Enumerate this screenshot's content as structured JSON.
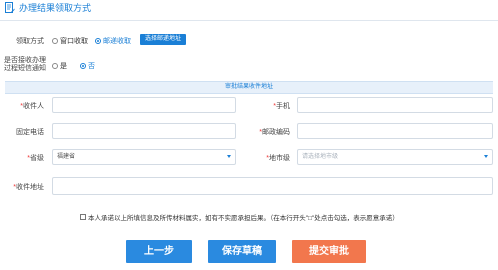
{
  "section": {
    "title": "办理结果领取方式"
  },
  "pickup": {
    "label": "领取方式",
    "options": [
      "窗口收取",
      "邮递收取"
    ],
    "selected_index": 1,
    "select_address_button": "选择邮递地址"
  },
  "sms": {
    "label_line1": "是否接收办理",
    "label_line2": "过程短信通知",
    "options": [
      "是",
      "否"
    ],
    "selected_index": 1
  },
  "band_title": "审批结果收件地址",
  "form": {
    "recipient_label": "收件人",
    "mobile_label": "手机",
    "phone_label": "固定电话",
    "postcode_label": "邮政编码",
    "province_label": "省级",
    "province_value": "福建省",
    "city_label": "地市级",
    "city_placeholder": "请选择地市级",
    "address_label": "收件地址",
    "required_mark": "*"
  },
  "commitment": "本人承诺以上所填信息及所传材料属实，如有不实愿承担后果。（在本行开头\"□\"处点击勾选，表示愿意承诺）",
  "buttons": {
    "prev": "上一步",
    "save": "保存草稿",
    "submit": "提交审批"
  },
  "colors": {
    "accent": "#1a7fd6",
    "submit": "#f2774d",
    "band": "#e7f0fa"
  }
}
